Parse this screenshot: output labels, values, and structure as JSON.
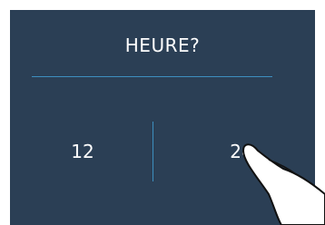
{
  "screen": {
    "title": "HEURE?",
    "options": [
      {
        "label": "12"
      },
      {
        "label": "24"
      }
    ],
    "selected_index": 1
  },
  "colors": {
    "background": "#2b3f55",
    "divider": "#3d8fbf",
    "text": "#ffffff"
  },
  "icons": {
    "pointer": "pointing-hand-icon"
  }
}
